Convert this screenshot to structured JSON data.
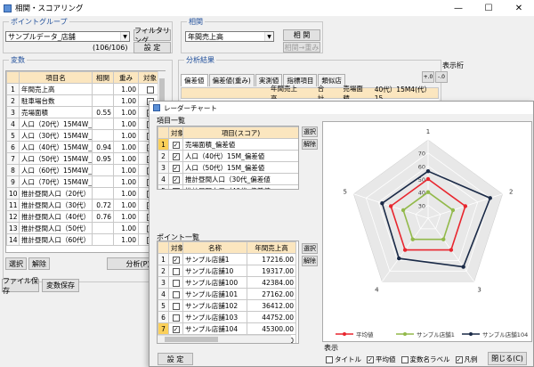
{
  "main": {
    "title": "相関・スコアリング",
    "controls": {
      "min": "—",
      "max": "☐",
      "close": "✕"
    },
    "point_group": {
      "label": "ポイントグループ",
      "selected": "サンプルデータ_店舗",
      "count": "(106/106)",
      "filter_btn": "フィルタリング",
      "set_btn": "設 定"
    },
    "correlation": {
      "label": "相関",
      "selected": "年間売上高",
      "corr_btn": "相 関",
      "weight_btn": "相関→重み"
    },
    "variables": {
      "label": "変数",
      "headers": [
        "",
        "項目名",
        "相関",
        "重み",
        "対象"
      ],
      "rows": [
        {
          "n": "1",
          "name": "年間売上高",
          "corr": "",
          "weight": "1.00",
          "on": false
        },
        {
          "n": "2",
          "name": "駐車場台数",
          "corr": "",
          "weight": "1.00",
          "on": false
        },
        {
          "n": "3",
          "name": "売場面積",
          "corr": "0.55",
          "weight": "1.00",
          "on": true
        },
        {
          "n": "4",
          "name": "人口（20代）15M4W_2k",
          "corr": "",
          "weight": "1.00",
          "on": false
        },
        {
          "n": "5",
          "name": "人口（30代）15M4W_2k",
          "corr": "",
          "weight": "1.00",
          "on": false
        },
        {
          "n": "6",
          "name": "人口（40代）15M4W_2k",
          "corr": "0.94",
          "weight": "1.00",
          "on": true
        },
        {
          "n": "7",
          "name": "人口（50代）15M4W_2k",
          "corr": "0.95",
          "weight": "1.00",
          "on": true
        },
        {
          "n": "8",
          "name": "人口（60代）15M4W_2k",
          "corr": "",
          "weight": "1.00",
          "on": false
        },
        {
          "n": "9",
          "name": "人口（70代）15M4W_2k",
          "corr": "",
          "weight": "1.00",
          "on": false
        },
        {
          "n": "10",
          "name": "推計昼間人口（20代）",
          "corr": "",
          "weight": "1.00",
          "on": false
        },
        {
          "n": "11",
          "name": "推計昼間人口（30代）",
          "corr": "0.72",
          "weight": "1.00",
          "on": true
        },
        {
          "n": "12",
          "name": "推計昼間人口（40代）",
          "corr": "0.76",
          "weight": "1.00",
          "on": true
        },
        {
          "n": "13",
          "name": "推計昼間人口（50代）",
          "corr": "",
          "weight": "1.00",
          "on": false
        },
        {
          "n": "14",
          "name": "推計昼間人口（60代）",
          "corr": "",
          "weight": "1.00",
          "on": false
        }
      ],
      "select_btn": "選択",
      "clear_btn": "解除",
      "analyze_btn": "分析(P)"
    },
    "file_save_btn": "ファイル保存",
    "var_save_btn": "変数保存",
    "analysis": {
      "label": "分析結果",
      "tabs": [
        "偏差値",
        "偏差値(重み)",
        "実測値",
        "指標項目",
        "類似店"
      ],
      "display_label": "表示桁",
      "header_cells": [
        "年間売上高",
        "合計",
        "売場面積",
        "40代）15M4(代）15"
      ]
    }
  },
  "radar": {
    "title": "レーダーチャート",
    "items": {
      "label": "項目一覧",
      "headers": [
        "",
        "対象",
        "項目(スコア)"
      ],
      "rows": [
        {
          "n": "1",
          "on": true,
          "name": "売場面積_偏差値"
        },
        {
          "n": "2",
          "on": true,
          "name": "人口（40代）15M_偏差値"
        },
        {
          "n": "3",
          "on": true,
          "name": "人口（50代）15M_偏差値"
        },
        {
          "n": "4",
          "on": true,
          "name": "推計昼間人口（30代_偏差値"
        },
        {
          "n": "5",
          "on": true,
          "name": "推計昼間人口（40代_偏差値"
        }
      ],
      "select_btn": "選択",
      "clear_btn": "解除"
    },
    "points": {
      "label": "ポイント一覧",
      "headers": [
        "",
        "対象",
        "名称",
        "年間売上高"
      ],
      "rows": [
        {
          "n": "1",
          "on": true,
          "name": "サンプル店舗1",
          "sales": "17216.00"
        },
        {
          "n": "2",
          "on": false,
          "name": "サンプル店舗10",
          "sales": "19317.00"
        },
        {
          "n": "3",
          "on": false,
          "name": "サンプル店舗100",
          "sales": "42384.00"
        },
        {
          "n": "4",
          "on": false,
          "name": "サンプル店舗101",
          "sales": "27162.00"
        },
        {
          "n": "5",
          "on": false,
          "name": "サンプル店舗102",
          "sales": "36412.00"
        },
        {
          "n": "6",
          "on": false,
          "name": "サンプル店舗103",
          "sales": "44752.00"
        },
        {
          "n": "7",
          "on": true,
          "name": "サンプル店舗104",
          "sales": "45300.00"
        },
        {
          "n": "8",
          "on": false,
          "name": "サンプル店舗105",
          "sales": "22187.00"
        }
      ],
      "select_btn": "選択",
      "clear_btn": "解除"
    },
    "set_btn": "設 定",
    "display": {
      "label": "表示",
      "options": [
        {
          "label": "タイトル",
          "on": false
        },
        {
          "label": "平均値",
          "on": true
        },
        {
          "label": "変数名ラベル",
          "on": false
        },
        {
          "label": "凡例",
          "on": true
        }
      ]
    },
    "close_btn": "閉じる(C)",
    "chart_data": {
      "type": "radar",
      "axes": [
        "1",
        "2",
        "3",
        "4",
        "5"
      ],
      "ticks": [
        "30",
        "40",
        "50",
        "60",
        "70"
      ],
      "rmin": 20,
      "rmax": 80,
      "series": [
        {
          "name": "平均値",
          "color": "#e8262e",
          "values": [
            50,
            50,
            50,
            50,
            50
          ]
        },
        {
          "name": "サンプル店舗1",
          "color": "#92b94a",
          "values": [
            40,
            40,
            40,
            40,
            40
          ]
        },
        {
          "name": "サンプル店舗104",
          "color": "#1a2a47",
          "values": [
            56,
            70,
            66,
            58,
            57
          ]
        }
      ]
    }
  }
}
